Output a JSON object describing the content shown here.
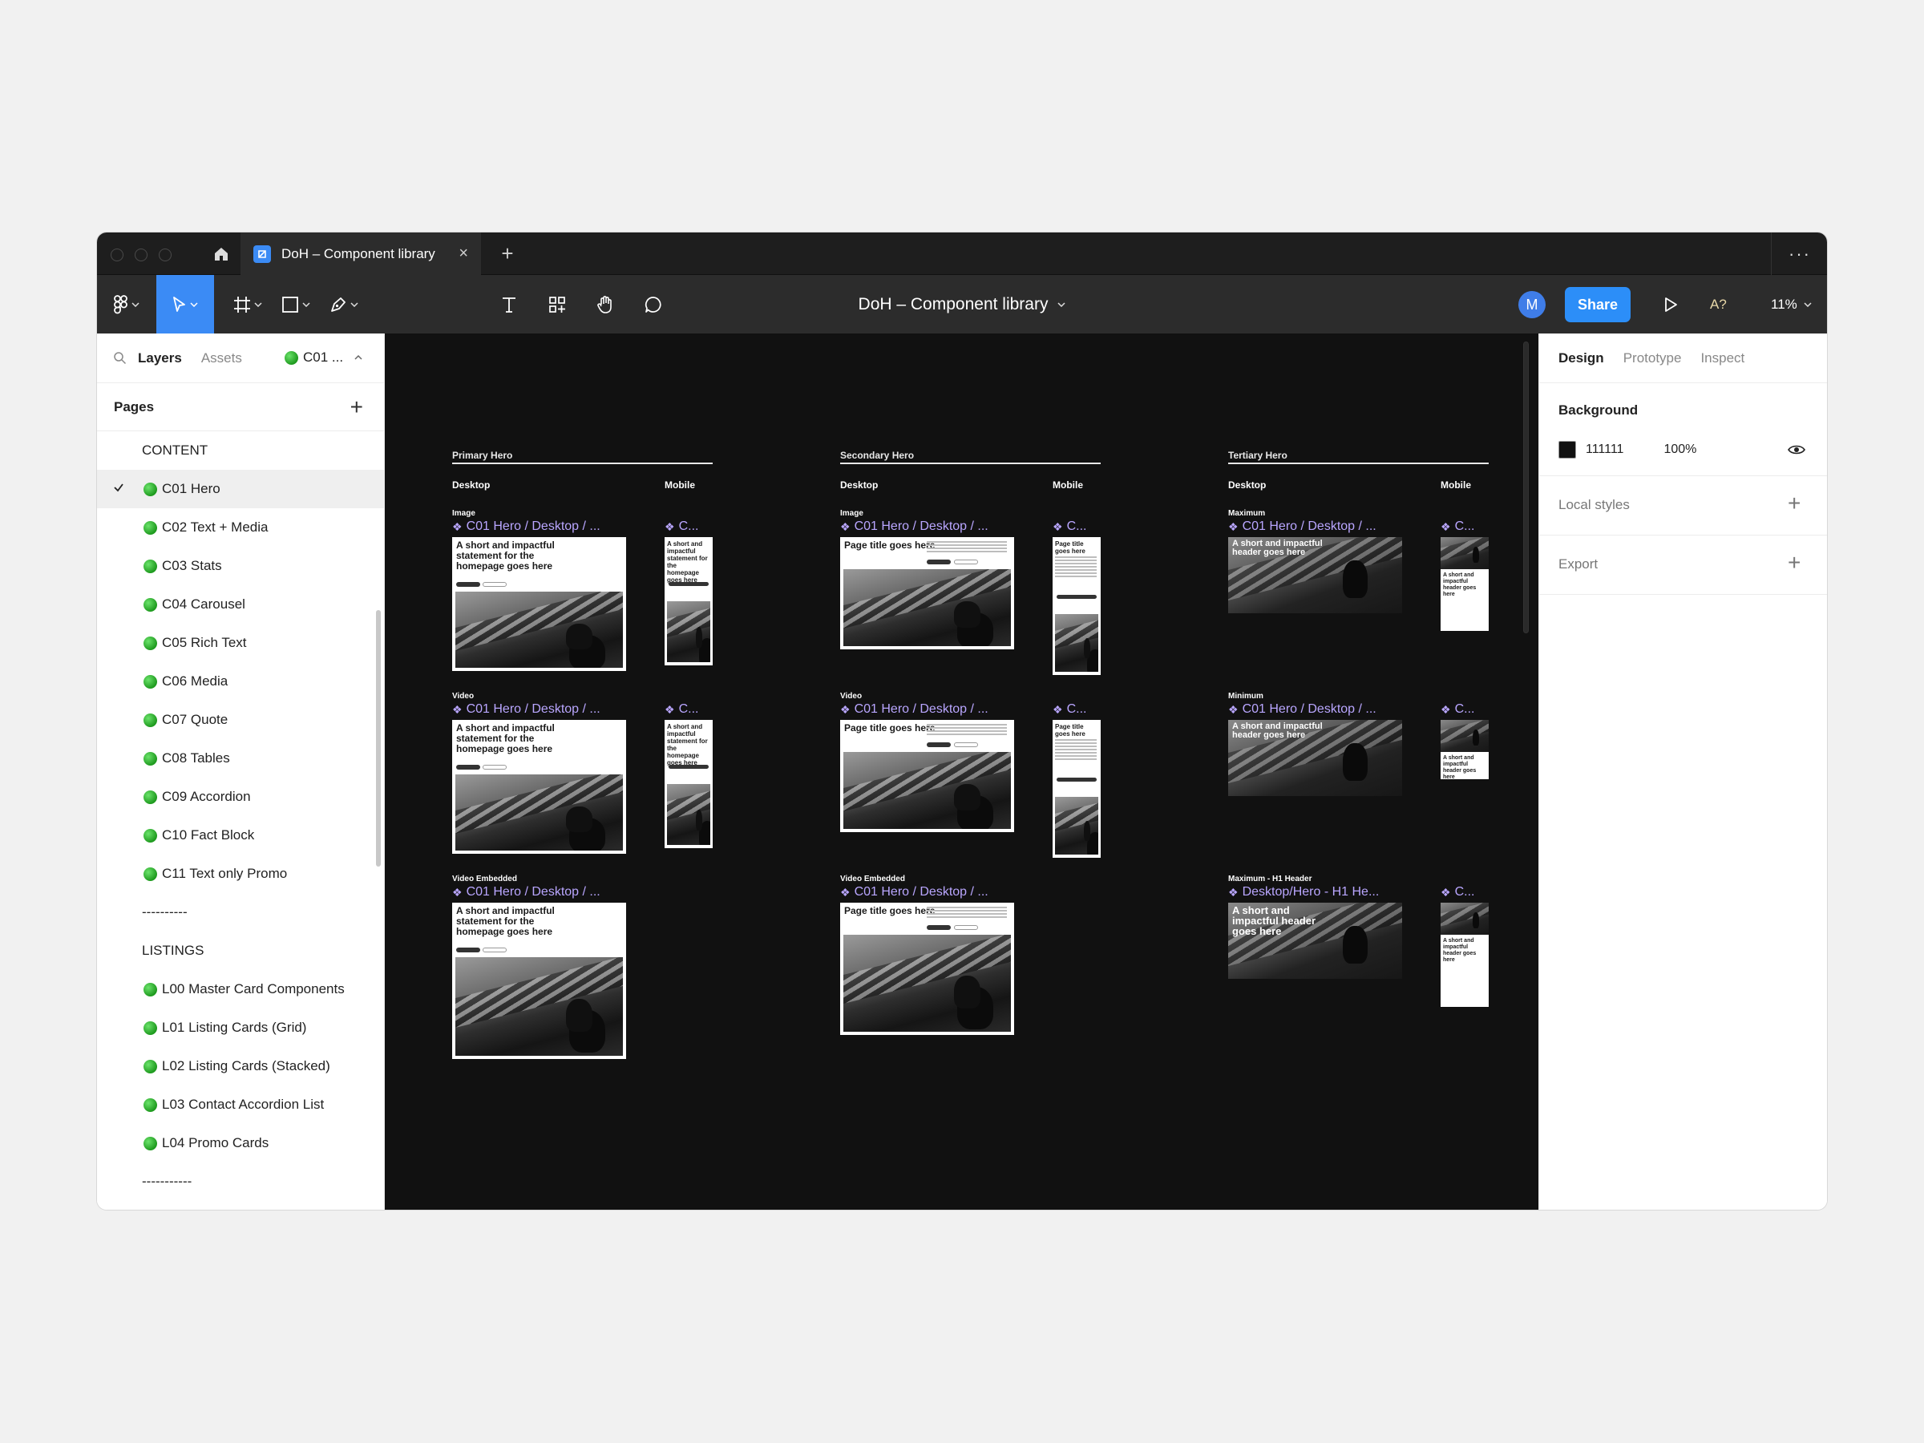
{
  "tabbar": {
    "tab_title": "DoH – Component library",
    "close_glyph": "×",
    "add_glyph": "+",
    "more_glyph": "···"
  },
  "toolbar": {
    "file_title": "DoH – Component library",
    "avatar_letter": "M",
    "share_label": "Share",
    "a11y_label": "A?",
    "zoom_label": "11%"
  },
  "left_panel": {
    "tabs": [
      "Layers",
      "Assets"
    ],
    "current_page_chip": "C01 ...",
    "pages_header": "Pages",
    "pages": [
      {
        "label": "CONTENT",
        "dot": false,
        "selected": false
      },
      {
        "label": "C01 Hero",
        "dot": true,
        "selected": true
      },
      {
        "label": "C02 Text + Media",
        "dot": true,
        "selected": false
      },
      {
        "label": "C03 Stats",
        "dot": true,
        "selected": false
      },
      {
        "label": "C04 Carousel",
        "dot": true,
        "selected": false
      },
      {
        "label": "C05 Rich Text",
        "dot": true,
        "selected": false
      },
      {
        "label": "C06 Media",
        "dot": true,
        "selected": false
      },
      {
        "label": "C07 Quote",
        "dot": true,
        "selected": false
      },
      {
        "label": "C08 Tables",
        "dot": true,
        "selected": false
      },
      {
        "label": "C09 Accordion",
        "dot": true,
        "selected": false
      },
      {
        "label": "C10 Fact Block",
        "dot": true,
        "selected": false
      },
      {
        "label": "C11 Text only Promo",
        "dot": true,
        "selected": false
      },
      {
        "label": "----------",
        "dot": false,
        "selected": false
      },
      {
        "label": "LISTINGS",
        "dot": false,
        "selected": false
      },
      {
        "label": "L00 Master Card Components",
        "dot": true,
        "selected": false
      },
      {
        "label": "L01 Listing Cards (Grid)",
        "dot": true,
        "selected": false
      },
      {
        "label": "L02 Listing Cards (Stacked)",
        "dot": true,
        "selected": false
      },
      {
        "label": "L03 Contact Accordion List",
        "dot": true,
        "selected": false
      },
      {
        "label": "L04 Promo Cards",
        "dot": true,
        "selected": false
      },
      {
        "label": "-----------",
        "dot": false,
        "selected": false
      }
    ]
  },
  "canvas": {
    "background": "#111111",
    "sections": [
      {
        "title": "Primary Hero",
        "desktop_label": "Desktop",
        "mobile_label": "Mobile",
        "rows": [
          {
            "label": "Image",
            "desktop_frame": "C01 Hero / Desktop / ...",
            "mobile_frame": "C...",
            "thumb_text": "A short and impactful statement for the homepage goes here",
            "mobile_text": "A short and impactful statement for the homepage goes here"
          },
          {
            "label": "Video",
            "desktop_frame": "C01 Hero / Desktop / ...",
            "mobile_frame": "C...",
            "thumb_text": "A short and impactful statement for the homepage goes here",
            "mobile_text": "A short and impactful statement for the homepage goes here"
          },
          {
            "label": "Video Embedded",
            "desktop_frame": "C01 Hero / Desktop / ...",
            "mobile_frame": "",
            "thumb_text": "A short and impactful statement for the homepage goes here",
            "mobile_text": ""
          }
        ]
      },
      {
        "title": "Secondary Hero",
        "desktop_label": "Desktop",
        "mobile_label": "Mobile",
        "rows": [
          {
            "label": "Image",
            "desktop_frame": "C01 Hero / Desktop / ...",
            "mobile_frame": "C...",
            "thumb_text": "Page title goes here",
            "mobile_text": "Page title goes here"
          },
          {
            "label": "Video",
            "desktop_frame": "C01 Hero / Desktop / ...",
            "mobile_frame": "C...",
            "thumb_text": "Page title goes here",
            "mobile_text": "Page title goes here"
          },
          {
            "label": "Video Embedded",
            "desktop_frame": "C01 Hero / Desktop / ...",
            "mobile_frame": "",
            "thumb_text": "Page title goes here",
            "mobile_text": ""
          }
        ]
      },
      {
        "title": "Tertiary Hero",
        "desktop_label": "Desktop",
        "mobile_label": "Mobile",
        "rows": [
          {
            "label": "Maximum",
            "desktop_frame": "C01 Hero / Desktop / ...",
            "mobile_frame": "C...",
            "thumb_text": "A short and impactful header goes here",
            "mobile_text": "A short and impactful header goes here"
          },
          {
            "label": "Minimum",
            "desktop_frame": "C01 Hero / Desktop / ...",
            "mobile_frame": "C...",
            "thumb_text": "A short and impactful header goes here",
            "mobile_text": "A short and impactful header goes here"
          },
          {
            "label": "Maximum - H1 Header",
            "desktop_frame": "Desktop/Hero - H1 He...",
            "mobile_frame": "C...",
            "thumb_text": "A short and impactful header goes here",
            "mobile_text": "A short and impactful header goes here"
          }
        ]
      }
    ]
  },
  "right_panel": {
    "tabs": [
      "Design",
      "Prototype",
      "Inspect"
    ],
    "background_header": "Background",
    "background_hex": "111111",
    "background_opacity": "100%",
    "local_styles_label": "Local styles",
    "export_label": "Export"
  }
}
